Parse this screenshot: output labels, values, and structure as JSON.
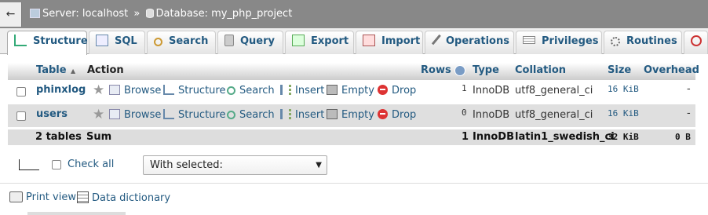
{
  "breadcrumb": {
    "back_label": "←",
    "server": "Server: localhost",
    "separator": "»",
    "database": "Database: my_php_project"
  },
  "tabs": [
    {
      "label": "Structure",
      "icon": "structure-icon",
      "active": true
    },
    {
      "label": "SQL",
      "icon": "sql-icon"
    },
    {
      "label": "Search",
      "icon": "search-icon"
    },
    {
      "label": "Query",
      "icon": "query-icon"
    },
    {
      "label": "Export",
      "icon": "export-icon"
    },
    {
      "label": "Import",
      "icon": "import-icon"
    },
    {
      "label": "Operations",
      "icon": "wrench-icon"
    },
    {
      "label": "Privileges",
      "icon": "privileges-icon"
    },
    {
      "label": "Routines",
      "icon": "routines-icon"
    },
    {
      "label": "",
      "icon": "clock-icon"
    }
  ],
  "table": {
    "headers": {
      "table": "Table",
      "sort_indicator": "▲",
      "action": "Action",
      "rows": "Rows",
      "type": "Type",
      "collation": "Collation",
      "size": "Size",
      "overhead": "Overhead"
    },
    "actions": {
      "browse": "Browse",
      "structure": "Structure",
      "search": "Search",
      "insert": "Insert",
      "empty": "Empty",
      "drop": "Drop"
    },
    "rows": [
      {
        "name": "phinxlog",
        "rows": "1",
        "type": "InnoDB",
        "collation": "utf8_general_ci",
        "size": "16 KiB",
        "overhead": "-"
      },
      {
        "name": "users",
        "rows": "0",
        "type": "InnoDB",
        "collation": "utf8_general_ci",
        "size": "16 KiB",
        "overhead": "-"
      }
    ],
    "summary": {
      "name": "2 tables",
      "label": "Sum",
      "rows": "1",
      "type": "InnoDB",
      "collation": "latin1_swedish_ci",
      "size": "32 KiB",
      "overhead": "0 B"
    }
  },
  "controls": {
    "check_all": "Check all",
    "with_selected": "With selected:"
  },
  "footer": {
    "print_view": "Print view",
    "data_dictionary": "Data dictionary"
  },
  "colors": {
    "link": "#235a81",
    "topbar": "#888888",
    "row_alt": "#dfdfdf"
  }
}
